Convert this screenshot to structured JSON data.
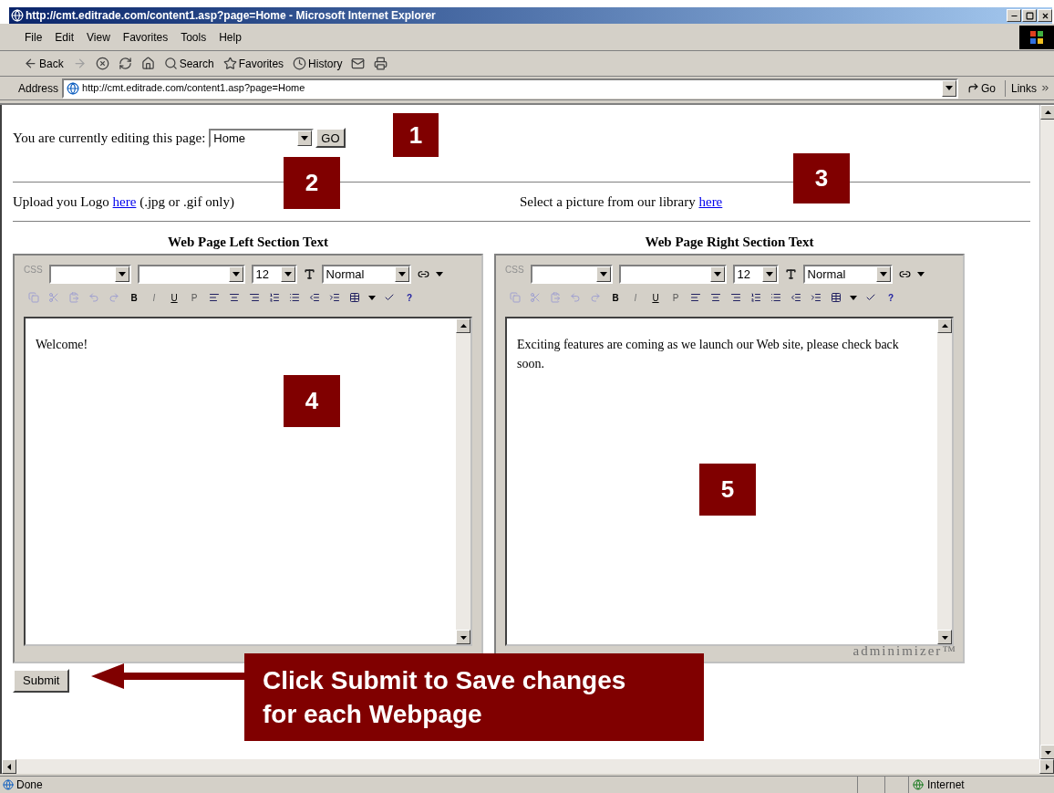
{
  "window": {
    "title": "http://cmt.editrade.com/content1.asp?page=Home - Microsoft Internet Explorer"
  },
  "menu": [
    "File",
    "Edit",
    "View",
    "Favorites",
    "Tools",
    "Help"
  ],
  "toolbar": [
    {
      "kind": "back",
      "label": "Back",
      "disabled": false
    },
    {
      "kind": "forward",
      "disabled": true
    },
    {
      "kind": "stop",
      "disabled": false
    },
    {
      "kind": "refresh",
      "disabled": false
    },
    {
      "kind": "home",
      "disabled": false
    },
    {
      "kind": "search",
      "label": "Search",
      "disabled": false
    },
    {
      "kind": "favorites",
      "label": "Favorites",
      "disabled": false
    },
    {
      "kind": "history",
      "label": "History",
      "disabled": false
    },
    {
      "kind": "mail",
      "disabled": false
    },
    {
      "kind": "print",
      "disabled": false
    }
  ],
  "address": {
    "label": "Address",
    "url": "http://cmt.editrade.com/content1.asp?page=Home",
    "go": "Go",
    "links": "Links"
  },
  "page": {
    "editing_label": "You are currently editing this page:",
    "page_select": "Home",
    "go_button": "GO",
    "upload": {
      "before": "Upload you Logo ",
      "link": "here",
      "after": " (.jpg or .gif only)"
    },
    "library": {
      "before": "Select a picture from our library ",
      "link": "here"
    },
    "editors": [
      {
        "title": "Web Page Left Section Text",
        "css_label": "CSS",
        "size": "12",
        "style": "Normal",
        "format_buttons": [
          "B",
          "I",
          "U",
          "P"
        ],
        "help": "?",
        "content": "Welcome!"
      },
      {
        "title": "Web Page Right Section Text",
        "css_label": "CSS",
        "size": "12",
        "style": "Normal",
        "format_buttons": [
          "B",
          "I",
          "U",
          "P"
        ],
        "help": "?",
        "content": "Exciting features are coming as we launch our Web site, please check back soon.",
        "logo": "adminimizer™"
      }
    ],
    "submit": "Submit"
  },
  "annotations": [
    {
      "number": "1"
    },
    {
      "number": "2"
    },
    {
      "number": "3"
    },
    {
      "number": "4"
    },
    {
      "number": "5"
    }
  ],
  "callout": {
    "text": "Click Submit to Save changes for each Webpage"
  },
  "status_bar": {
    "text": "Done",
    "zone": "Internet"
  }
}
